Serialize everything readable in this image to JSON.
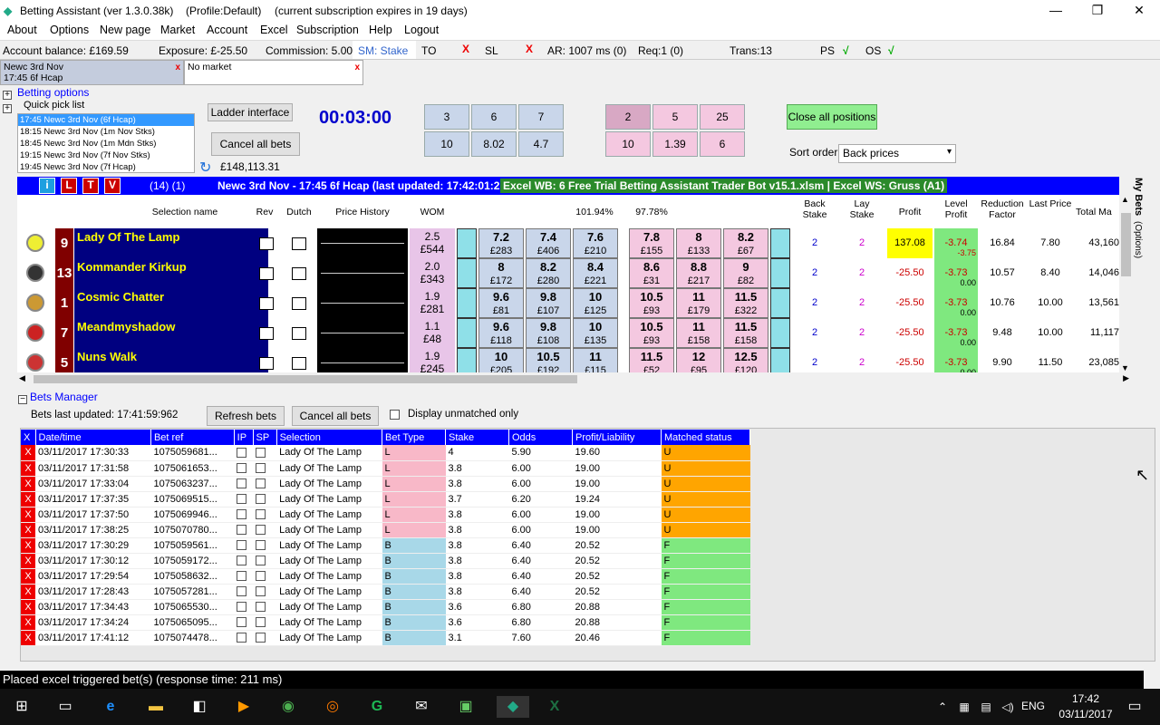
{
  "app": {
    "title": "Betting Assistant (ver 1.3.0.38k)",
    "profile": "(Profile:Default)",
    "subscription": "(current subscription expires in 19 days)"
  },
  "menu": [
    "About",
    "Options",
    "New page",
    "Market",
    "Account",
    "Excel",
    "Subscription",
    "Help",
    "Logout"
  ],
  "status": {
    "balance": "Account balance: £169.59",
    "exposure": "Exposure: £-25.50",
    "commission": "Commission: 5.00%",
    "sm": "SM: Stake",
    "to": "TO",
    "sl": "SL",
    "ar": "AR: 1007 ms (0)",
    "req": "Req:1 (0)",
    "trans": "Trans:13",
    "ps": "PS",
    "os": "OS",
    "tick": "√",
    "x": "X"
  },
  "market_tabs": [
    {
      "line1": "Newc 3rd Nov",
      "line2": "17:45 6f Hcap"
    },
    {
      "line1": "No market",
      "line2": ""
    }
  ],
  "options": {
    "betting_options": "Betting options",
    "quick_pick_list": "Quick pick list",
    "quick_items": [
      "17:45 Newc 3rd Nov (6f Hcap)",
      "18:15 Newc 3rd Nov (1m Nov Stks)",
      "18:45 Newc 3rd Nov (1m Mdn Stks)",
      "19:15 Newc 3rd Nov (7f Nov Stks)",
      "19:45 Newc 3rd Nov (7f Hcap)"
    ],
    "ladder_interface": "Ladder interface",
    "cancel_all_bets": "Cancel all bets",
    "matched_total": "£148,113.31",
    "timer": "00:03:00",
    "back_stakes": [
      "3",
      "6",
      "7",
      "10",
      "8.02",
      "4.7"
    ],
    "lay_stakes": [
      "2",
      "5",
      "25",
      "10",
      "1.39",
      "6"
    ],
    "close_all": "Close all positions",
    "sort_order": "Sort order",
    "sort_value": "Back prices"
  },
  "market_header": {
    "btn_i": "i",
    "btn_l": "L",
    "btn_t": "T",
    "btn_v": "V",
    "count": "(14) (1)",
    "title": "Newc 3rd Nov - 17:45 6f Hcap (last updated: 17:42:01:229)",
    "excel": "Excel WB: 6 Free Trial Betting Assistant Trader Bot v15.1.xlsm | Excel WS: Gruss (A1)"
  },
  "grid_headers": {
    "selection": "Selection name",
    "rev": "Rev",
    "dutch": "Dutch",
    "history": "Price History",
    "wom": "WOM",
    "back_pct": "101.94%",
    "lay_pct": "97.78%",
    "back_stake": "Back Stake",
    "lay_stake": "Lay Stake",
    "profit": "Profit",
    "level_profit": "Level Profit",
    "reduction": "Reduction Factor",
    "last_price": "Last Price",
    "total": "Total Ma"
  },
  "side_tabs": {
    "my_bets": "My Bets",
    "options": "(Options)"
  },
  "runners": [
    {
      "num": "9",
      "name": "Lady Of The Lamp",
      "wom1": "2.5",
      "wom2": "£544",
      "back": [
        [
          "7.2",
          "£283"
        ],
        [
          "7.4",
          "£406"
        ],
        [
          "7.6",
          "£210"
        ]
      ],
      "lay": [
        [
          "7.8",
          "£155"
        ],
        [
          "8",
          "£133"
        ],
        [
          "8.2",
          "£67"
        ]
      ],
      "bs": "2",
      "ls": "2",
      "profit": "137.08",
      "lp": "-3.74",
      "lp2": "-3.75",
      "rf": "16.84",
      "last": "7.80",
      "total": "43,160"
    },
    {
      "num": "13",
      "name": "Kommander Kirkup",
      "wom1": "2.0",
      "wom2": "£343",
      "back": [
        [
          "8",
          "£172"
        ],
        [
          "8.2",
          "£280"
        ],
        [
          "8.4",
          "£221"
        ]
      ],
      "lay": [
        [
          "8.6",
          "£31"
        ],
        [
          "8.8",
          "£217"
        ],
        [
          "9",
          "£82"
        ]
      ],
      "bs": "2",
      "ls": "2",
      "profit": "-25.50",
      "lp": "-3.73",
      "lp2": "0.00",
      "rf": "10.57",
      "last": "8.40",
      "total": "14,046"
    },
    {
      "num": "1",
      "name": "Cosmic Chatter",
      "wom1": "1.9",
      "wom2": "£281",
      "back": [
        [
          "9.6",
          "£81"
        ],
        [
          "9.8",
          "£107"
        ],
        [
          "10",
          "£125"
        ]
      ],
      "lay": [
        [
          "10.5",
          "£93"
        ],
        [
          "11",
          "£179"
        ],
        [
          "11.5",
          "£322"
        ]
      ],
      "bs": "2",
      "ls": "2",
      "profit": "-25.50",
      "lp": "-3.73",
      "lp2": "0.00",
      "rf": "10.76",
      "last": "10.00",
      "total": "13,561"
    },
    {
      "num": "7",
      "name": "Meandmyshadow",
      "wom1": "1.1",
      "wom2": "£48",
      "back": [
        [
          "9.6",
          "£118"
        ],
        [
          "9.8",
          "£108"
        ],
        [
          "10",
          "£135"
        ]
      ],
      "lay": [
        [
          "10.5",
          "£93"
        ],
        [
          "11",
          "£158"
        ],
        [
          "11.5",
          "£158"
        ]
      ],
      "bs": "2",
      "ls": "2",
      "profit": "-25.50",
      "lp": "-3.73",
      "lp2": "0.00",
      "rf": "9.48",
      "last": "10.00",
      "total": "11,117"
    },
    {
      "num": "5",
      "name": "Nuns Walk",
      "wom1": "1.9",
      "wom2": "£245",
      "back": [
        [
          "10",
          "£205"
        ],
        [
          "10.5",
          "£192"
        ],
        [
          "11",
          "£115"
        ]
      ],
      "lay": [
        [
          "11.5",
          "£52"
        ],
        [
          "12",
          "£95"
        ],
        [
          "12.5",
          "£120"
        ]
      ],
      "bs": "2",
      "ls": "2",
      "profit": "-25.50",
      "lp": "-3.73",
      "lp2": "0.00",
      "rf": "9.90",
      "last": "11.50",
      "total": "23,085"
    }
  ],
  "bets": {
    "title": "Bets Manager",
    "last_updated": "Bets last updated: 17:41:59:962",
    "refresh": "Refresh bets",
    "cancel": "Cancel all bets",
    "unmatched_only": "Display unmatched only",
    "headers": [
      "X",
      "Date/time",
      "Bet ref",
      "IP",
      "SP",
      "Selection",
      "Bet Type",
      "Stake",
      "Odds",
      "Profit/Liability",
      "Matched status"
    ],
    "rows": [
      [
        "03/11/2017 17:30:33",
        "1075059681...",
        "Lady Of The Lamp",
        "L",
        "4",
        "5.90",
        "19.60",
        "U"
      ],
      [
        "03/11/2017 17:31:58",
        "1075061653...",
        "Lady Of The Lamp",
        "L",
        "3.8",
        "6.00",
        "19.00",
        "U"
      ],
      [
        "03/11/2017 17:33:04",
        "1075063237...",
        "Lady Of The Lamp",
        "L",
        "3.8",
        "6.00",
        "19.00",
        "U"
      ],
      [
        "03/11/2017 17:37:35",
        "1075069515...",
        "Lady Of The Lamp",
        "L",
        "3.7",
        "6.20",
        "19.24",
        "U"
      ],
      [
        "03/11/2017 17:37:50",
        "1075069946...",
        "Lady Of The Lamp",
        "L",
        "3.8",
        "6.00",
        "19.00",
        "U"
      ],
      [
        "03/11/2017 17:38:25",
        "1075070780...",
        "Lady Of The Lamp",
        "L",
        "3.8",
        "6.00",
        "19.00",
        "U"
      ],
      [
        "03/11/2017 17:30:29",
        "1075059561...",
        "Lady Of The Lamp",
        "B",
        "3.8",
        "6.40",
        "20.52",
        "F"
      ],
      [
        "03/11/2017 17:30:12",
        "1075059172...",
        "Lady Of The Lamp",
        "B",
        "3.8",
        "6.40",
        "20.52",
        "F"
      ],
      [
        "03/11/2017 17:29:54",
        "1075058632...",
        "Lady Of The Lamp",
        "B",
        "3.8",
        "6.40",
        "20.52",
        "F"
      ],
      [
        "03/11/2017 17:28:43",
        "1075057281...",
        "Lady Of The Lamp",
        "B",
        "3.8",
        "6.40",
        "20.52",
        "F"
      ],
      [
        "03/11/2017 17:34:43",
        "1075065530...",
        "Lady Of The Lamp",
        "B",
        "3.6",
        "6.80",
        "20.88",
        "F"
      ],
      [
        "03/11/2017 17:34:24",
        "1075065095...",
        "Lady Of The Lamp",
        "B",
        "3.6",
        "6.80",
        "20.88",
        "F"
      ],
      [
        "03/11/2017 17:41:12",
        "1075074478...",
        "Lady Of The Lamp",
        "B",
        "3.1",
        "7.60",
        "20.46",
        "F"
      ]
    ]
  },
  "statusbar": "Placed excel triggered bet(s) (response time: 211 ms)",
  "taskbar": {
    "lang": "ENG",
    "time": "17:42",
    "date": "03/11/2017",
    "notif": "1"
  },
  "colors": {
    "accent": "#0000ff",
    "runner_num": "#800000",
    "runner_name_bg": "#000080",
    "runner_name_fg": "#ffff00"
  }
}
